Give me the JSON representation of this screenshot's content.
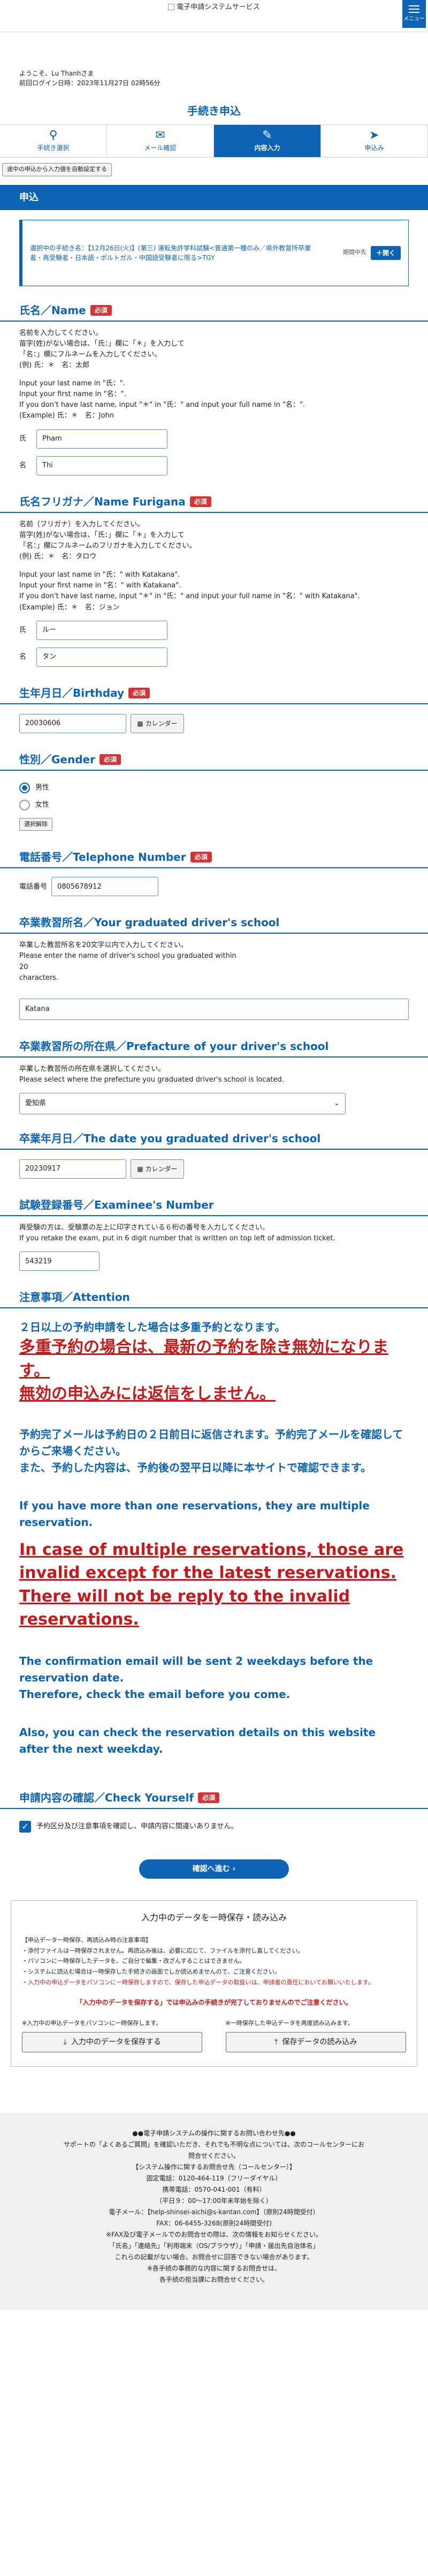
{
  "header": {
    "logo_text": "電子申請システムサービス",
    "menu_label": "メニュー"
  },
  "user": {
    "greeting": "ようこそ、Lu Thanhさま",
    "last_login": "前回ログイン日時：2023年11月27日 02時56分"
  },
  "page_title": "手続き申込",
  "steps": [
    {
      "label": "手続き選択",
      "icon": "search-icon"
    },
    {
      "label": "メール確認",
      "icon": "mail-icon"
    },
    {
      "label": "内容入力",
      "icon": "pencil-icon"
    },
    {
      "label": "申込み",
      "icon": "send-icon"
    }
  ],
  "autosave_button": "途中の申込から入力値を自動設定する",
  "apply_section": "申込",
  "exam_box": {
    "text": "選択中の手続き名：【12月26日(火)】(第三) 運転免許学科試験<普通第一種のみ／県外教習所卒業者・再受験者・日本語・ポルトガル・中国語受験者に限る>TGY",
    "period_label": "期間中先",
    "open_button": "＋開く"
  },
  "name_field": {
    "title": "氏名／Name",
    "required": "必須",
    "desc": [
      "名前を入力してください。",
      "苗字(姓)がない場合は、「氏：」欄に「＊」を入力して",
      "「名：」欄にフルネームを入力してください。",
      "(例) 氏：＊　名：太郎",
      "",
      "Input your last name in \"氏：\".",
      "Input your first name in \"名：\".",
      "If you don't have last name, input \"＊\" in \"氏：\" and input your full name in \"名：\".",
      "(Example) 氏：＊　名：John"
    ],
    "last_label": "氏",
    "last_value": "Pham",
    "first_label": "名",
    "first_value": "Thi"
  },
  "furigana_field": {
    "title": "氏名フリガナ／Name Furigana",
    "required": "必須",
    "desc": [
      "名前（フリガナ）を入力してください。",
      "苗字(姓)がない場合は、「氏：」欄に「＊」を入力して",
      "「名：」欄にフルネームのフリガナを入力してください。",
      "(例) 氏：＊　名：タロウ",
      "",
      "Input your last name in \"氏：\" with Katakana\".",
      "Input your first name in \"名：\" with Katakana\".",
      "If you don't have last name, input \"＊\" in \"氏：\" and input your full name in \"名：\" with Katakana\".",
      "(Example) 氏：＊　名：ジョン"
    ],
    "last_label": "氏",
    "last_value": "ルー",
    "first_label": "名",
    "first_value": "タン"
  },
  "birthday_field": {
    "title": "生年月日／Birthday",
    "required": "必須",
    "value": "20030606",
    "calendar_button": "カレンダー"
  },
  "gender_field": {
    "title": "性別／Gender",
    "required": "必須",
    "options": [
      "男性",
      "女性"
    ],
    "selected": "男性",
    "clear_button": "選択解除"
  },
  "phone_field": {
    "title": "電話番号／Telephone Number",
    "required": "必須",
    "label": "電話番号",
    "value": "0805678912"
  },
  "school_field": {
    "title": "卒業教習所名／Your graduated driver's school",
    "desc": [
      "卒業した教習所名を20文字以内で入力してください。",
      "Please enter the name of driver's school you graduated within 20",
      "characters."
    ],
    "value": "Katana"
  },
  "prefecture_field": {
    "title": "卒業教習所の所在県／Prefacture of your driver's school",
    "desc": [
      "卒業した教習所の所在県を選択してください。",
      "Please select where the prefecture you graduated driver's school is located."
    ],
    "value": "愛知県"
  },
  "graddate_field": {
    "title": "卒業年月日／The date you graduated driver's school",
    "value": "20230917",
    "calendar_button": "カレンダー"
  },
  "examinee_field": {
    "title": "試験登録番号／Examinee's Number",
    "desc": [
      "再受験の方は、受験票の左上に印字されている６桁の番号を入力してください。",
      "If you retake the exam, put in 6 digit number that is written on top left of admission ticket."
    ],
    "value": "543219"
  },
  "attention": {
    "title": "注意事項／Attention",
    "line1": "２日以上の予約申請をした場合は多重予約となります。",
    "red1": "多重予約の場合は、最新の予約を除き無効になります。",
    "red2": "無効の申込みには返信をしません。",
    "line2": "予約完了メールは予約日の２日前日に返信されます。予約完了メールを確認してからご来場ください。",
    "line3": "また、予約した内容は、予約後の翌平日以降に本サイトで確認できます。",
    "line4": "If you have more than one reservations, they are multiple reservation.",
    "red3": "In case of multiple reservations, those are invalid except for the latest reservations.",
    "red4": "There will not be reply to the invalid reservations.",
    "line5": "The confirmation email will be sent 2 weekdays before the reservation date.",
    "line6": "Therefore, check the email before you come.",
    "line7": "Also, you can check the reservation details on this website after the next weekday."
  },
  "confirm_field": {
    "title": "申請内容の確認／Check Yourself",
    "required": "必須",
    "checkbox_label": "予約区分及び注意事項を確認し、申請内容に間違いありません。"
  },
  "submit_button": "確認へ進む",
  "save_box": {
    "title": "入力中のデータを一時保存・読み込み",
    "notes": [
      "【申込データ一時保存、再読込み時の注意事項】",
      "・添付ファイルは一時保存されません。再読込み後は、必要に応じて、ファイルを添付し直してください。",
      "・パソコンに一時保存したデータを、ご自分で編集・改ざんすることはできません。",
      "・システムに読込む場合は一時保存した手続きの画面でしか読込めませんので、ご注意ください。",
      "・入力中の申込データをパソコンに一時保存しますので、保存した申込データの取扱いは、申請者の責任においてお願いいたします。"
    ],
    "warning": "「入力中のデータを保存する」では申込みの手続きが完了しておりませんのでご注意ください。",
    "save_caption": "※入力中の申込データをパソコンに一時保存します。",
    "save_button": "入力中のデータを保存する",
    "load_caption": "※一時保存した申込データを再度読み込みます。",
    "load_button": "保存データの読み込み"
  },
  "footer": {
    "lines": [
      "●●電子申請システムの操作に関するお問い合わせ先●●",
      "サポートの「よくあるご質問」を確認いただき、それでも不明な点については、次のコールセンターにお",
      "問合せください。",
      "【システム操作に関するお問合せ先（コールセンター）】",
      "固定電話：0120-464-119（フリーダイヤル）",
      "携帯電話：0570-041-001（有料）",
      "（平日９：00～17:00年末年始を除く）",
      "電子メール：【help-shinsei-aichi@s-kantan.com】（原則24時間受付）",
      "FAX：06-6455-3268(原則24時間受付)",
      "※FAX及び電子メールでのお問合せの際は、次の情報をお知らせください。",
      "「氏名」「連絡先」「利用端末（OS/ブラウザ）」「申請・届出先自治体名」",
      "これらの記載がない場合、お問合せに回答できない場合があります。",
      "※各手続の事務的な内容に関するお問合せは、",
      "各手続の担当課にお問合せください。"
    ]
  }
}
